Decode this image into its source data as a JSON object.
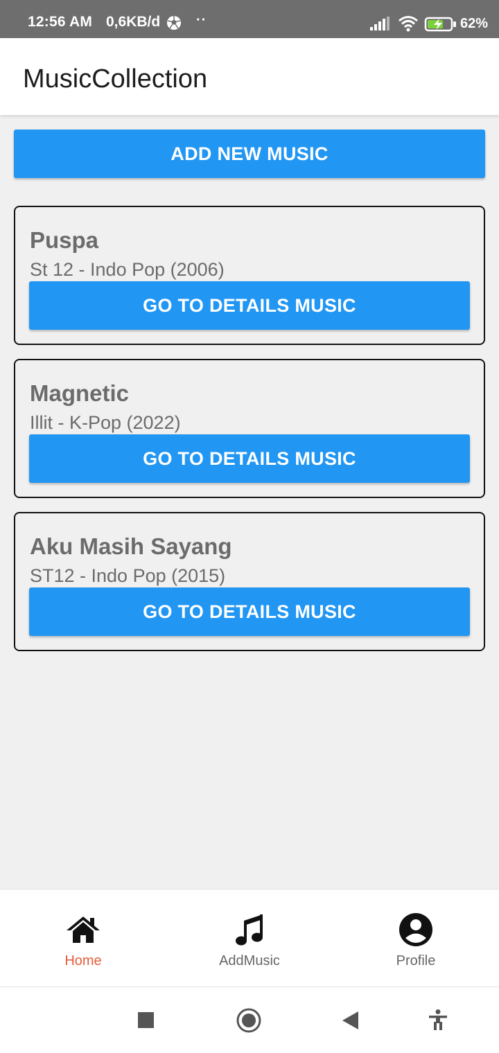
{
  "status_bar": {
    "time": "12:56 AM",
    "data_rate": "0,6KB/d",
    "dots": "··",
    "battery_percent": "62%"
  },
  "app_bar": {
    "title": "MusicCollection"
  },
  "add_button": {
    "label": "ADD NEW MUSIC"
  },
  "cards": [
    {
      "title": "Puspa",
      "subtitle": "St 12 - Indo Pop (2006)",
      "button_label": "GO TO DETAILS MUSIC"
    },
    {
      "title": "Magnetic",
      "subtitle": "Illit - K-Pop (2022)",
      "button_label": "GO TO DETAILS MUSIC"
    },
    {
      "title": "Aku Masih Sayang",
      "subtitle": "ST12 - Indo Pop (2015)",
      "button_label": "GO TO DETAILS MUSIC"
    }
  ],
  "bottom_nav": {
    "items": [
      {
        "label": "Home",
        "icon": "home-icon",
        "active": true
      },
      {
        "label": "AddMusic",
        "icon": "music-note-icon",
        "active": false
      },
      {
        "label": "Profile",
        "icon": "account-circle-icon",
        "active": false
      }
    ]
  },
  "colors": {
    "primary": "#2196f3",
    "active_nav": "#e65c3c",
    "status_bar": "#6e6e6e",
    "background": "#f0f0f0"
  }
}
